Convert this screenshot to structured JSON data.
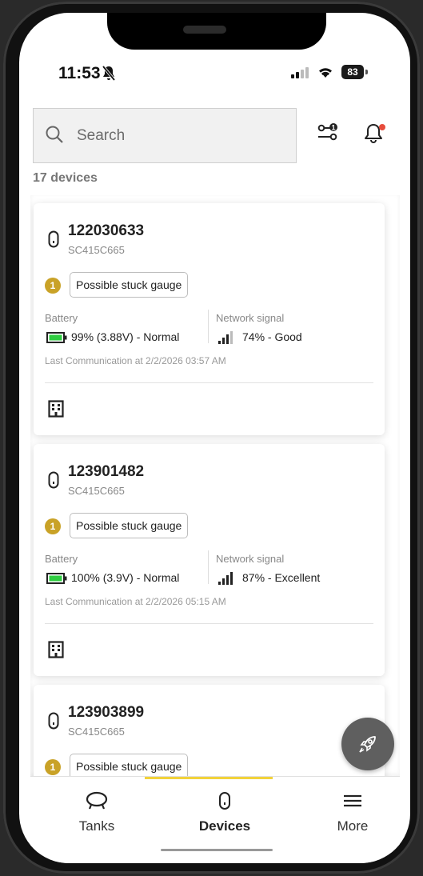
{
  "status_bar": {
    "time": "11:53",
    "battery": "83"
  },
  "search": {
    "placeholder": "Search"
  },
  "device_count": "17 devices",
  "devices": [
    {
      "id": "122030633",
      "serial": "SC415C665",
      "alert_count": "1",
      "alert_text": "Possible stuck gauge",
      "battery_label": "Battery",
      "battery_value": "99% (3.88V) - Normal",
      "signal_label": "Network signal",
      "signal_value": "74% - Good",
      "last_comm": "Last Communication at 2/2/2026 03:57 AM"
    },
    {
      "id": "123901482",
      "serial": "SC415C665",
      "alert_count": "1",
      "alert_text": "Possible stuck gauge",
      "battery_label": "Battery",
      "battery_value": "100% (3.9V) - Normal",
      "signal_label": "Network signal",
      "signal_value": "87% - Excellent",
      "last_comm": "Last Communication at 2/2/2026 05:15 AM"
    },
    {
      "id": "123903899",
      "serial": "SC415C665",
      "alert_count": "1",
      "alert_text": "Possible stuck gauge"
    }
  ],
  "tabs": [
    {
      "label": "Tanks",
      "icon": "tank-icon"
    },
    {
      "label": "Devices",
      "icon": "device-icon",
      "active": true
    },
    {
      "label": "More",
      "icon": "menu-icon"
    }
  ],
  "colors": {
    "accent": "#f2d23a",
    "alert": "#c9a227",
    "battery_ok": "#2ecc40",
    "fab": "#5f5f5f",
    "notif_dot": "#e74c3c"
  }
}
